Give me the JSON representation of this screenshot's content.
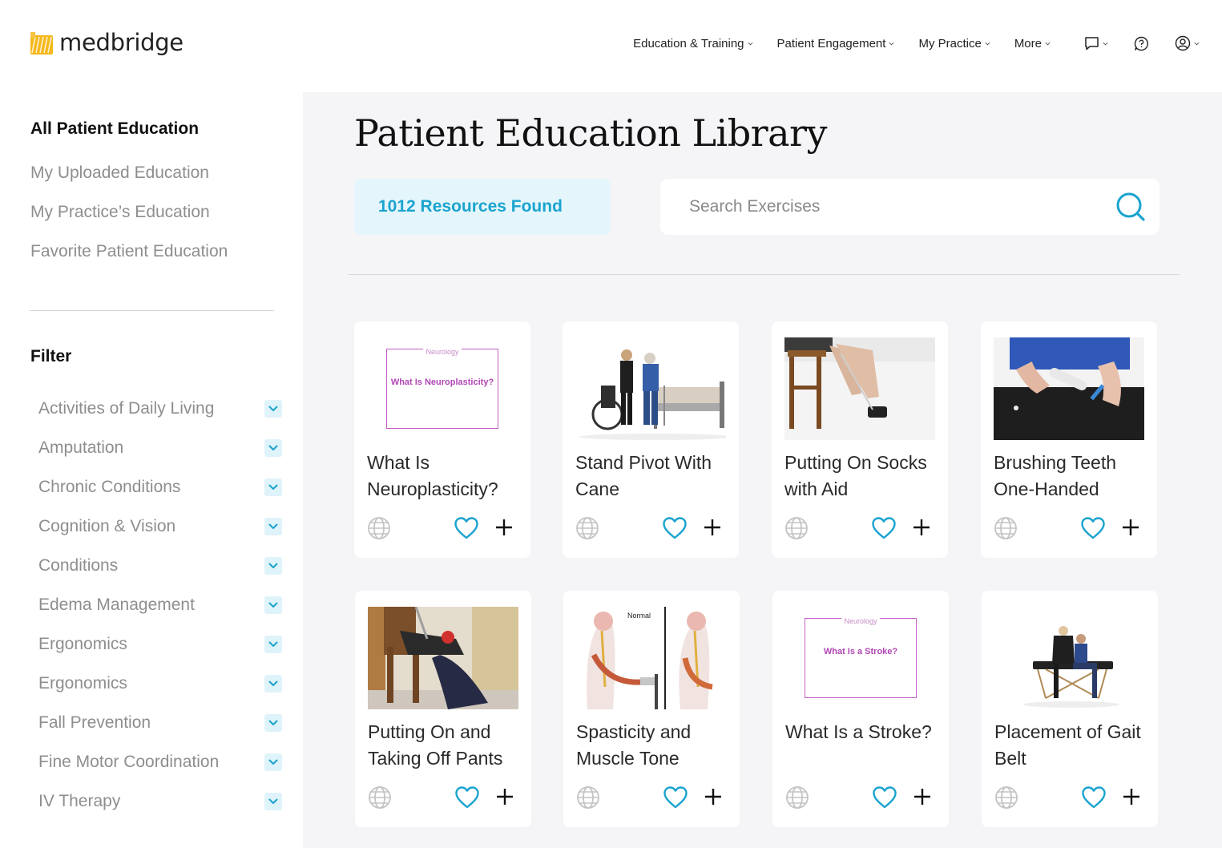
{
  "brand": {
    "name": "medbridge",
    "accent": "#1ba3cf",
    "logo_color": "#f5b81a"
  },
  "nav": {
    "items": [
      "Education & Training",
      "Patient Engagement",
      "My Practice",
      "More"
    ],
    "icons": [
      "chat-icon",
      "help-icon",
      "account-icon"
    ]
  },
  "sidebar": {
    "title": "All Patient Education",
    "links": [
      "My Uploaded Education",
      "My Practice’s Education",
      "Favorite Patient Education"
    ],
    "filter_title": "Filter",
    "filters": [
      "Activities of Daily Living",
      "Amputation",
      "Chronic Conditions",
      "Cognition & Vision",
      "Conditions",
      "Edema Management",
      "Ergonomics",
      "Ergonomics",
      "Fall Prevention",
      "Fine Motor Coordination",
      "IV Therapy"
    ]
  },
  "main": {
    "title": "Patient Education Library",
    "results": "1012 Resources Found",
    "search_placeholder": "Search Exercises",
    "cards": [
      {
        "title": "What Is Neuroplasticity?",
        "thumb": "slide",
        "slide_tag": "Neurology",
        "slide_text": "What Is Neuroplasticity?"
      },
      {
        "title": "Stand Pivot With Cane",
        "thumb": "photo-bed"
      },
      {
        "title": "Putting On Socks with Aid",
        "thumb": "photo-socks"
      },
      {
        "title": "Brushing Teeth One-Handed",
        "thumb": "photo-teeth"
      },
      {
        "title": "Putting On and Taking Off Pants",
        "thumb": "photo-pants"
      },
      {
        "title": "Spasticity and Muscle Tone",
        "thumb": "illustration-spine",
        "thumb_label": "Normal"
      },
      {
        "title": "What Is a Stroke?",
        "thumb": "slide",
        "slide_tag": "Neurology",
        "slide_text": "What Is a Stroke?"
      },
      {
        "title": "Placement of Gait Belt",
        "thumb": "photo-gait"
      }
    ]
  }
}
